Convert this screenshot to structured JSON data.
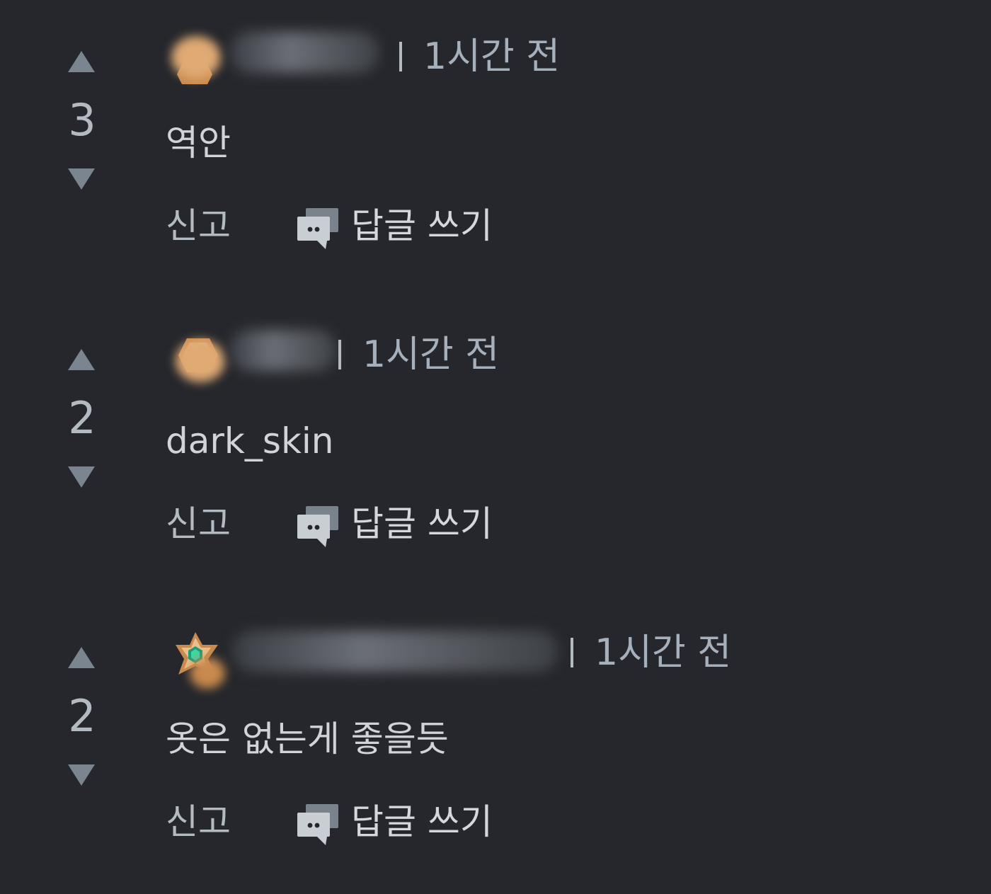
{
  "colors": {
    "background": "#25272c",
    "arrow": "#7b858f",
    "text": "#d0d4d9",
    "time": "#a6b0bc"
  },
  "comments": [
    {
      "score": "3",
      "time": "1시간 전",
      "text": "역안",
      "report_label": "신고",
      "reply_label": "답글 쓰기",
      "avatar_icon": "bronze-hexagon-badge-icon"
    },
    {
      "score": "2",
      "time": "1시간 전",
      "text": "dark_skin",
      "report_label": "신고",
      "reply_label": "답글 쓰기",
      "avatar_icon": "bronze-hexagon-badge-icon"
    },
    {
      "score": "2",
      "time": "1시간 전",
      "text": "옷은 없는게 좋을듯",
      "report_label": "신고",
      "reply_label": "답글 쓰기",
      "avatar_icon": "emerald-star-badge-icon"
    }
  ]
}
